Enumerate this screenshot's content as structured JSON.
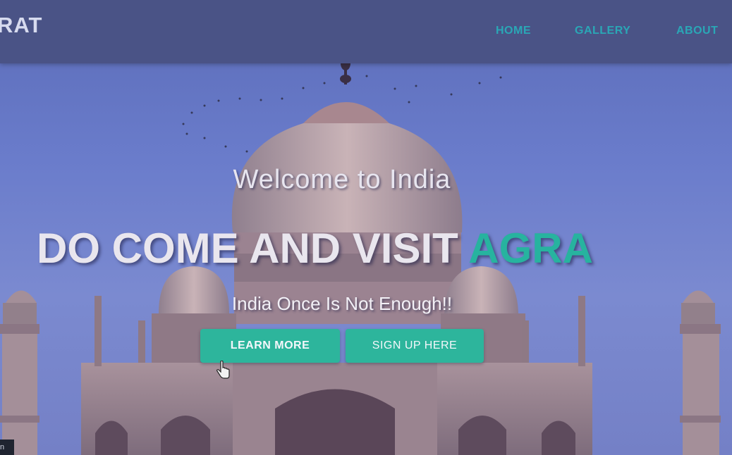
{
  "nav": {
    "brand": "RAT",
    "links": [
      "HOME",
      "GALLERY",
      "ABOUT"
    ]
  },
  "hero": {
    "welcome": "Welcome to India",
    "headline_main": "DO COME AND VISIT ",
    "headline_accent": "AGRA",
    "tagline": "India Once Is Not Enough!!",
    "learn_more": "LEARN MORE",
    "sign_up": "SIGN UP HERE"
  },
  "corner": {
    "label": "n"
  },
  "colors": {
    "navbar": "#4a5386",
    "nav_link": "#2aa7b6",
    "accent": "#27b39f",
    "button": "#2db59c",
    "sky": "#6a7ccb"
  },
  "icons": [
    "mouse-pointer-icon"
  ]
}
